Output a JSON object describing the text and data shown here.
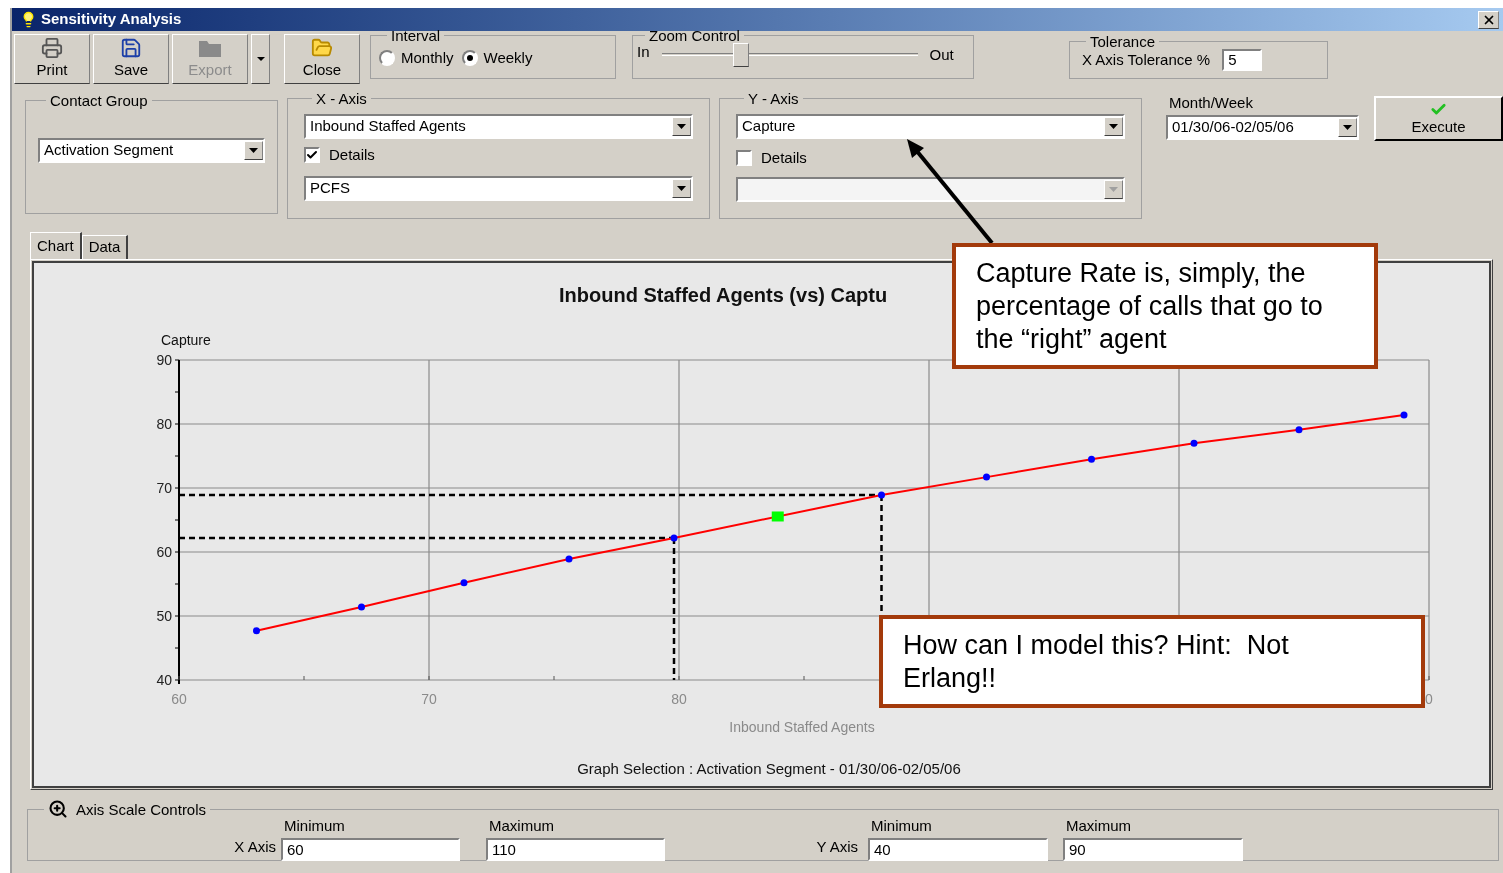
{
  "window": {
    "title": "Sensitivity Analysis"
  },
  "toolbar": [
    {
      "kind": "print",
      "label": "Print",
      "disabled": false
    },
    {
      "kind": "save",
      "label": "Save",
      "disabled": false
    },
    {
      "kind": "export",
      "label": "Export",
      "disabled": true
    },
    {
      "kind": "menu",
      "disabled": false
    },
    {
      "kind": "close",
      "label": "Close",
      "disabled": false
    }
  ],
  "interval": {
    "title": "Interval",
    "options": [
      {
        "label": "Monthly",
        "selected": false
      },
      {
        "label": "Weekly",
        "selected": true
      }
    ]
  },
  "zoom": {
    "title": "Zoom Control",
    "min_label": "In",
    "max_label": "Out",
    "level": 0.31
  },
  "tolerance": {
    "title": "Tolerance",
    "label": "X Axis Tolerance %",
    "value": "5"
  },
  "contact_group": {
    "title": "Contact Group",
    "value": "Activation Segment"
  },
  "x_axis": {
    "title": "X - Axis",
    "value": "Inbound Staffed Agents",
    "details": {
      "label": "Details",
      "checked": true
    },
    "detail_value": "PCFS",
    "detail_disabled": false
  },
  "y_axis": {
    "title": "Y - Axis",
    "value": "Capture",
    "details": {
      "label": "Details",
      "checked": false
    },
    "detail_disabled": true
  },
  "month_week": {
    "label": "Month/Week",
    "value": "01/30/06-02/05/06"
  },
  "execute": {
    "label": "Execute"
  },
  "tabs": [
    {
      "label": "Chart",
      "selected": true
    },
    {
      "label": "Data",
      "selected": false
    }
  ],
  "chart": {
    "title": "Inbound Staffed Agents (vs) Captu",
    "footer": "Graph Selection : Activation Segment - 01/30/06-02/05/06",
    "chart_data": {
      "type": "line",
      "xlabel": "Inbound Staffed Agents",
      "ylabel": "Capture",
      "xlim": [
        60,
        110
      ],
      "ylim": [
        40,
        90
      ],
      "xticks": [
        60,
        70,
        80
      ],
      "yticks": [
        40,
        50,
        60,
        70,
        80,
        90
      ],
      "grid": true,
      "ref_lines": [
        {
          "axis": "y",
          "value": 62.2
        },
        {
          "axis": "x",
          "value": 79.8
        },
        {
          "axis": "y",
          "value": 68.9
        },
        {
          "axis": "x",
          "value": 88.1
        }
      ],
      "x": [
        63.1,
        67.3,
        71.4,
        75.6,
        79.8,
        88.1,
        92.3,
        96.5,
        100.6,
        104.8,
        109
      ],
      "series": [
        {
          "color": "#ff0000",
          "marker": "circle",
          "values": [
            47.7,
            51.4,
            55.2,
            58.9,
            62.2,
            68.9,
            71.7,
            74.5,
            77.0,
            79.1,
            81.4
          ]
        }
      ]
    },
    "partial_tick": "0"
  },
  "axis_scale": {
    "title": "Axis Scale Controls",
    "x_label": "X Axis",
    "y_label": "Y Axis",
    "fields": [
      {
        "label": "Minimum",
        "value": "60"
      },
      {
        "label": "Maximum",
        "value": "110"
      },
      {
        "label": "Minimum",
        "value": "40"
      },
      {
        "label": "Maximum",
        "value": "90"
      }
    ]
  },
  "callouts": [
    "Capture Rate is, simply, the percentage of calls that go to the “right” agent",
    "How can I model this? Hint:  Not Erlang!!"
  ]
}
